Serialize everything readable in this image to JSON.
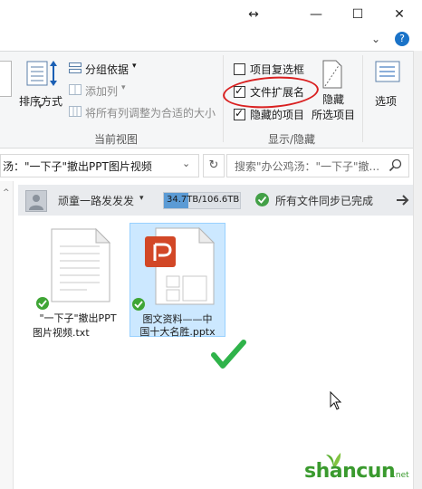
{
  "title_bar": {
    "resize_icon": "↔",
    "minimize": "—",
    "maximize": "☐",
    "close": "✕",
    "help": "?",
    "collapse": "⌄"
  },
  "ribbon": {
    "sort_label": "排序方式",
    "group_by": "分组依据",
    "add_column": "添加列",
    "fit_columns": "将所有列调整为合适的大小",
    "group_current_view": "当前视图",
    "item_checkboxes": "项目复选框",
    "file_extensions": "文件扩展名",
    "hidden_items": "隐藏的项目",
    "hide_selected_1": "隐藏",
    "hide_selected_2": "所选项目",
    "options": "选项",
    "group_show_hide": "显示/隐藏"
  },
  "address": {
    "path": "汤：\"一下子\"撤出PPT图片视频",
    "search_placeholder": "搜索\"办公鸡汤：\"一下子\"撤..."
  },
  "sync": {
    "user": "顽童一路发发发",
    "storage": "34.7TB/106.6TB",
    "storage_fraction": 0.326,
    "status": "所有文件同步已完成",
    "status_color": "#43a047"
  },
  "files": [
    {
      "line1": "\"一下子\"撤出PPT",
      "line2": "图片视频.txt"
    },
    {
      "line1": "图文资料——中",
      "line2": "国十大名胜.pptx"
    }
  ],
  "colors": {
    "ppt_orange": "#d24726",
    "check_green": "#3fa535",
    "highlight_red": "#d92020",
    "selection_bg": "#cce8ff"
  },
  "watermark": {
    "text": "shancun",
    "sub": ".net"
  }
}
